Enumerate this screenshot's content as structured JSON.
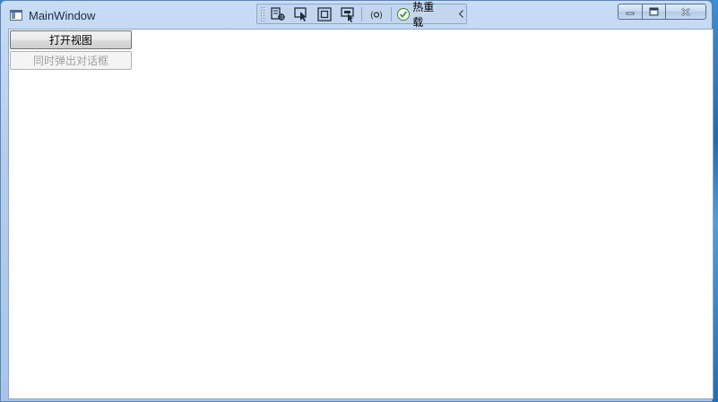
{
  "window": {
    "title": "MainWindow"
  },
  "debug_toolbar": {
    "tools": [
      {
        "icon": "select-element-icon"
      },
      {
        "icon": "pointer-select-icon"
      },
      {
        "icon": "display-layout-adorner-icon"
      },
      {
        "icon": "track-focus-icon"
      },
      {
        "icon": "binding-failures-icon"
      }
    ],
    "hot_reload_label": "热重载",
    "hot_reload_status_icon": "check-circle-icon",
    "collapse_icon": "chevron-left-icon"
  },
  "caption_buttons": {
    "minimize": "minimize-icon",
    "maximize": "maximize-icon",
    "close": "close-icon"
  },
  "content": {
    "open_view_button": "打开视图",
    "show_dialog_button": "同时弹出对话框"
  },
  "colors": {
    "titlebar": "#b4cdee",
    "client_background": "#ffffff",
    "disabled_text": "#a0a0a0",
    "reload_ok": "#2f8a2f"
  }
}
